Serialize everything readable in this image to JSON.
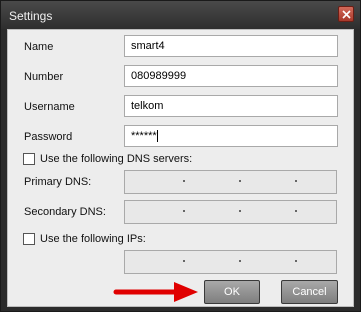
{
  "window": {
    "title": "Settings",
    "close_icon": "close-icon"
  },
  "fields": [
    {
      "label": "Name",
      "value": "smart4"
    },
    {
      "label": "Number",
      "value": "080989999"
    },
    {
      "label": "Username",
      "value": "telkom"
    },
    {
      "label": "Password",
      "value": "******"
    }
  ],
  "dns": {
    "checkbox_label": "Use the following DNS servers:",
    "checked": false,
    "primary_label": "Primary DNS:",
    "secondary_label": "Secondary DNS:"
  },
  "ips": {
    "checkbox_label": "Use the following IPs:",
    "checked": false
  },
  "buttons": {
    "ok": "OK",
    "cancel": "Cancel"
  },
  "annotation": {
    "arrow_color": "#e00000",
    "arrow_icon": "red-arrow-right-icon"
  }
}
